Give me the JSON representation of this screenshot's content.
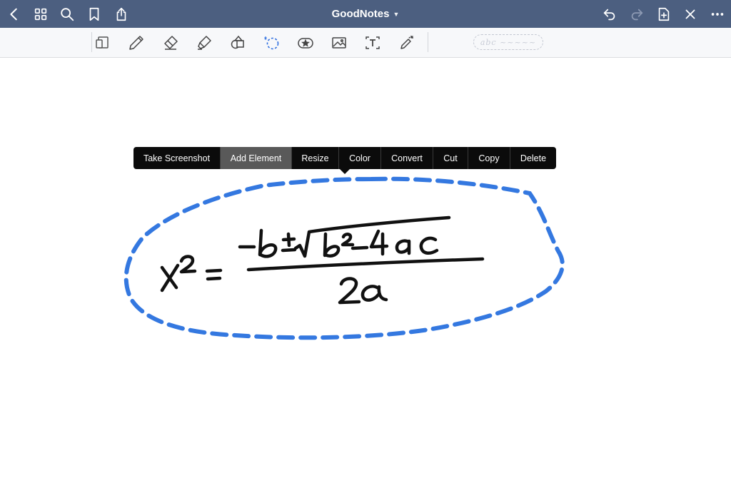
{
  "app": {
    "title": "GoodNotes"
  },
  "nav": {
    "left_icons": [
      "back-icon",
      "grid-icon",
      "search-icon",
      "bookmark-icon",
      "share-icon"
    ],
    "right_icons": [
      "undo-icon",
      "redo-icon",
      "add-page-icon",
      "close-icon",
      "more-icon"
    ]
  },
  "toolbar": {
    "tools": [
      "page-format-icon",
      "pen-icon",
      "eraser-icon",
      "highlighter-icon",
      "shapes-icon",
      "lasso-icon",
      "sticker-icon",
      "image-icon",
      "text-box-icon",
      "laser-pointer-icon"
    ],
    "selected_tool": "lasso",
    "pen_preview_text": "abc ~~~~~"
  },
  "context_menu": {
    "items": [
      "Take Screenshot",
      "Add Element",
      "Resize",
      "Color",
      "Convert",
      "Cut",
      "Copy",
      "Delete"
    ],
    "highlighted": "Add Element"
  },
  "handwriting": {
    "text": "x² = -b ± √(b² - 4ac) / 2a",
    "ink_color": "#111111",
    "lasso_color": "#3478e0"
  },
  "colors": {
    "navbar": "#4c5f80",
    "toolbar": "#f7f8fa",
    "lasso_blue": "#3478e0"
  }
}
